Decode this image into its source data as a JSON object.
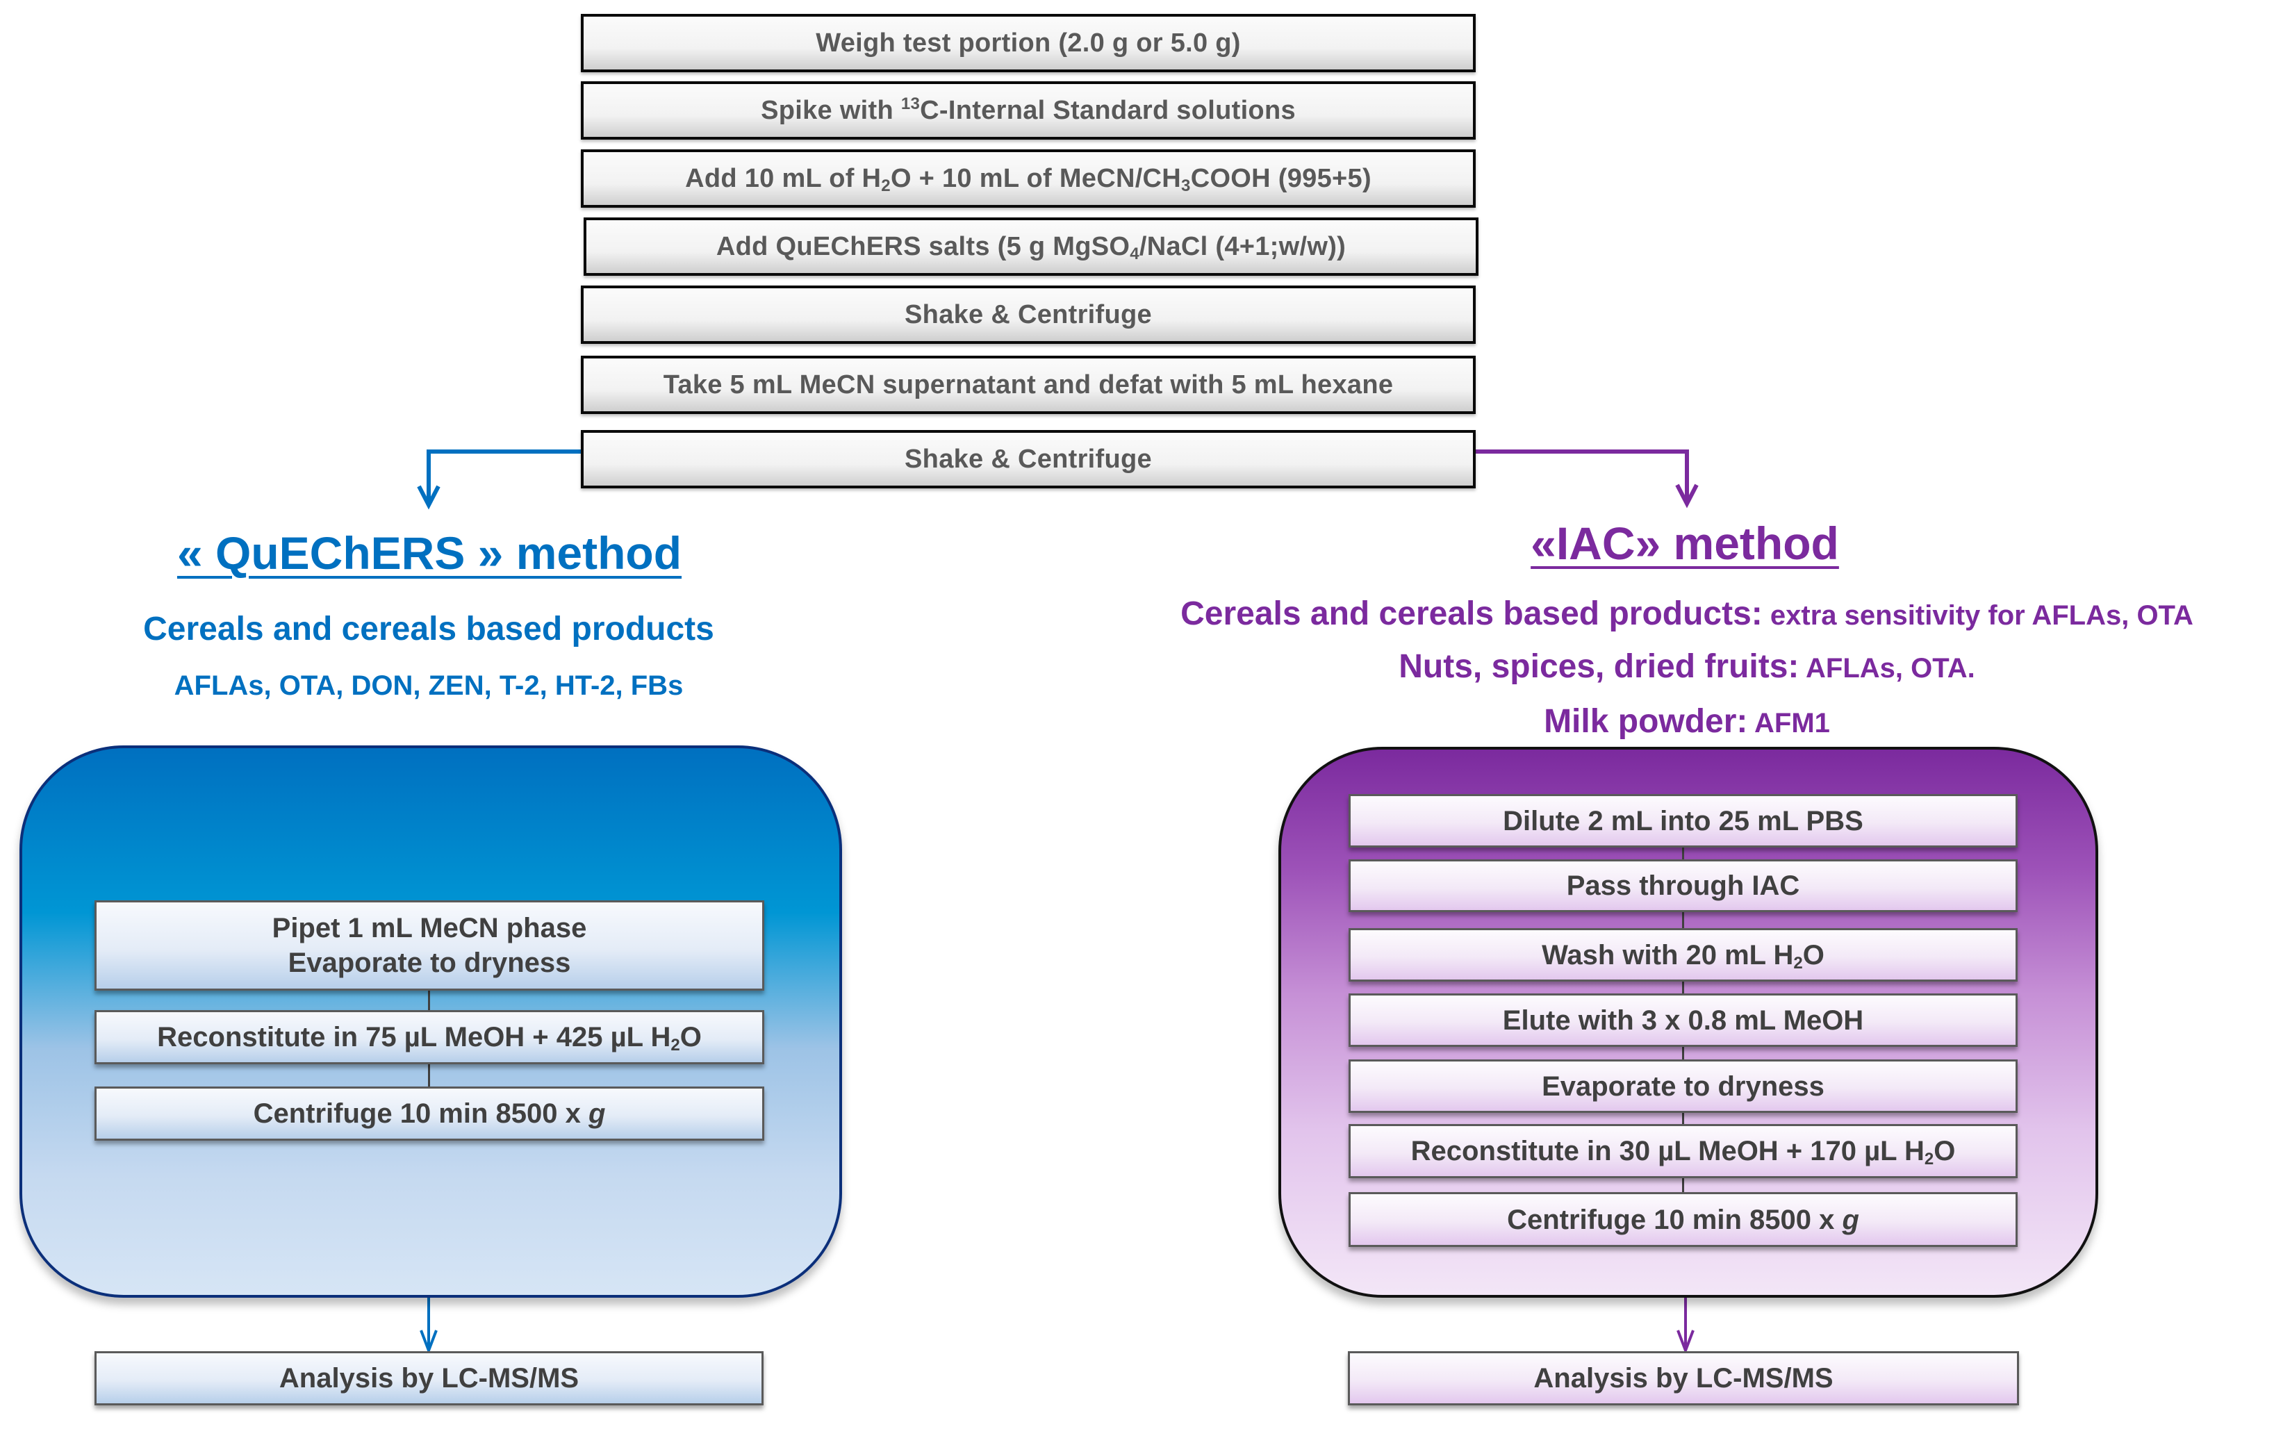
{
  "common_steps": [
    {
      "text": "Weigh test portion (2.0 g or 5.0 g)"
    },
    {
      "pre": "Spike with ",
      "sup": "13",
      "post": "C-Internal Standard solutions"
    },
    {
      "pre": "Add 10 mL of H",
      "sub": "2",
      "mid": "O + 10 mL of MeCN/CH",
      "sub2": "3",
      "post": "COOH (995+5)"
    },
    {
      "pre": "Add QuEChERS salts (5 g MgSO",
      "sub": "4",
      "post": "/NaCl (4+1;w/w))"
    },
    {
      "text": "Shake & Centrifuge"
    },
    {
      "text": "Take 5 mL MeCN supernatant and defat with 5 mL hexane"
    },
    {
      "text": "Shake & Centrifuge"
    }
  ],
  "colors": {
    "quechers_accent": "#0070C0",
    "iac_accent": "#7B2A9E",
    "step_text": "#595959"
  },
  "quechers": {
    "title": "« QuEChERS » method",
    "matrix": "Cereals and cereals based products",
    "analytes": "AFLAs, OTA, DON, ZEN, T-2, HT-2, FBs",
    "steps": [
      {
        "line1": "Pipet 1 mL MeCN phase",
        "line2": "Evaporate to dryness"
      },
      {
        "pre": "Reconstitute in 75 µL MeOH + 425 µL H",
        "sub": "2",
        "post": "O"
      },
      {
        "pre": "Centrifuge 10 min 8500 x ",
        "italic": "g"
      }
    ],
    "final_step": "Analysis by LC-MS/MS"
  },
  "iac": {
    "title": "«IAC» method",
    "matrices": [
      {
        "label": "Cereals and cereals based products:",
        "detail": " extra sensitivity for AFLAs, OTA"
      },
      {
        "label": "Nuts, spices, dried fruits:",
        "detail": " AFLAs, OTA."
      },
      {
        "label": "Milk powder:",
        "detail": " AFM1"
      }
    ],
    "steps": [
      {
        "text": "Dilute 2 mL into 25 mL PBS"
      },
      {
        "text": "Pass through IAC"
      },
      {
        "pre": "Wash with 20 mL H",
        "sub": "2",
        "post": "O"
      },
      {
        "text": "Elute with 3 x 0.8 mL MeOH"
      },
      {
        "text": "Evaporate to dryness"
      },
      {
        "pre": "Reconstitute in 30 µL MeOH + 170 µL H",
        "sub": "2",
        "post": "O"
      },
      {
        "pre": "Centrifuge 10 min 8500 x ",
        "italic": "g"
      }
    ],
    "final_step": "Analysis by LC-MS/MS"
  }
}
